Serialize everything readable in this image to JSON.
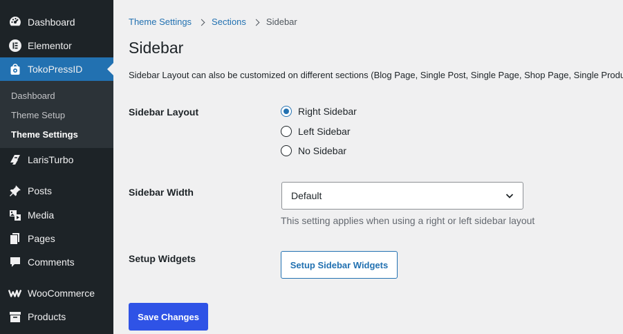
{
  "sidebar": {
    "items": [
      {
        "label": "Dashboard",
        "icon": "dashboard-icon"
      },
      {
        "label": "Elementor",
        "icon": "elementor-icon"
      },
      {
        "label": "TokoPressID",
        "icon": "tokopress-icon"
      },
      {
        "label": "LarisTurbo",
        "icon": "laristurbo-icon"
      },
      {
        "label": "Posts",
        "icon": "pin-icon"
      },
      {
        "label": "Media",
        "icon": "media-icon"
      },
      {
        "label": "Pages",
        "icon": "pages-icon"
      },
      {
        "label": "Comments",
        "icon": "comment-icon"
      },
      {
        "label": "WooCommerce",
        "icon": "woocommerce-icon"
      },
      {
        "label": "Products",
        "icon": "archive-icon"
      }
    ],
    "submenu": [
      "Dashboard",
      "Theme Setup",
      "Theme Settings"
    ],
    "active_color": "#2271b1"
  },
  "breadcrumb": {
    "items": [
      "Theme Settings",
      "Sections"
    ],
    "current": "Sidebar"
  },
  "page": {
    "title": "Sidebar",
    "description": "Sidebar Layout can also be customized on different sections (Blog Page, Single Post, Single Page, Shop Page, Single Product)"
  },
  "fields": {
    "layout": {
      "label": "Sidebar Layout",
      "options": [
        "Right Sidebar",
        "Left Sidebar",
        "No Sidebar"
      ],
      "selected": "Right Sidebar"
    },
    "width": {
      "label": "Sidebar Width",
      "value": "Default",
      "help": "This setting applies when using a right or left sidebar layout"
    },
    "widgets": {
      "label": "Setup Widgets",
      "button": "Setup Sidebar Widgets"
    }
  },
  "save_button": "Save Changes",
  "colors": {
    "primary_button": "#2f53e6",
    "link": "#2271b1",
    "sidebar_bg": "#1d2327"
  }
}
